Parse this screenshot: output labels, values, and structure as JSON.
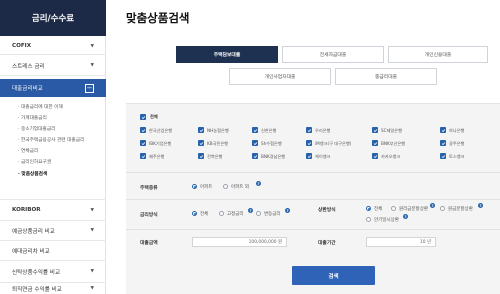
{
  "sidebar": {
    "title": "금리/수수료",
    "items": [
      {
        "label": "COFIX",
        "bold": true
      },
      {
        "label": "스트레스 금리"
      },
      {
        "label": "대출금리비교",
        "active": true,
        "toggle": "−"
      },
      {
        "label": "KORIBOR",
        "bold": true
      },
      {
        "label": "예금상품금리 비교"
      },
      {
        "label": "예대금리차 비교"
      },
      {
        "label": "신탁상품수익률 비교"
      },
      {
        "label": "퇴직연금 수익률 비교"
      }
    ],
    "subitems": [
      "· 대출금리에 대한 이해",
      "· 가계대출금리",
      "· 중소기업대출금리",
      "· 한국주택금융공사 관련 대출금리",
      "· 연체금리",
      "· 금리인하요구권",
      "· 맞춤상품검색"
    ]
  },
  "main": {
    "title": "맞춤상품검색",
    "tabs": [
      "주택담보대출",
      "전세자금대출",
      "개인신용대출",
      "개인사업자대출",
      "중금리대출"
    ],
    "all_label": "전체",
    "banks": [
      "한국산업은행",
      "NH농협은행",
      "신한은행",
      "우리은행",
      "SC제일은행",
      "하나은행",
      "IBK기업은행",
      "KB국민은행",
      "Sh수협은행",
      "iM뱅크(구 대구은행)",
      "BNK부산은행",
      "광주은행",
      "제주은행",
      "전북은행",
      "BNK경남은행",
      "케이뱅크",
      "카카오뱅크",
      "토스뱅크"
    ],
    "collateral": {
      "label": "주택종류",
      "options": [
        "아파트",
        "아파트 외"
      ],
      "selected": "아파트"
    },
    "rate_type": {
      "label": "금리방식",
      "options": [
        "전체",
        "고정금리",
        "변동금리"
      ],
      "selected": "전체"
    },
    "repay": {
      "label": "상환방식",
      "options": [
        "전체",
        "원리금분할상환",
        "원금분할상환",
        "만기일시상환"
      ],
      "selected": "전체"
    },
    "amount": {
      "label": "대출금액",
      "value": "100,000,000 원"
    },
    "period": {
      "label": "대출기간",
      "value": "10 년"
    },
    "search_label": "검색"
  },
  "colors": {
    "navy": "#1c2a48",
    "accent": "#2463ac",
    "active_menu": "#2a5aa5",
    "button": "#2f63b7"
  }
}
